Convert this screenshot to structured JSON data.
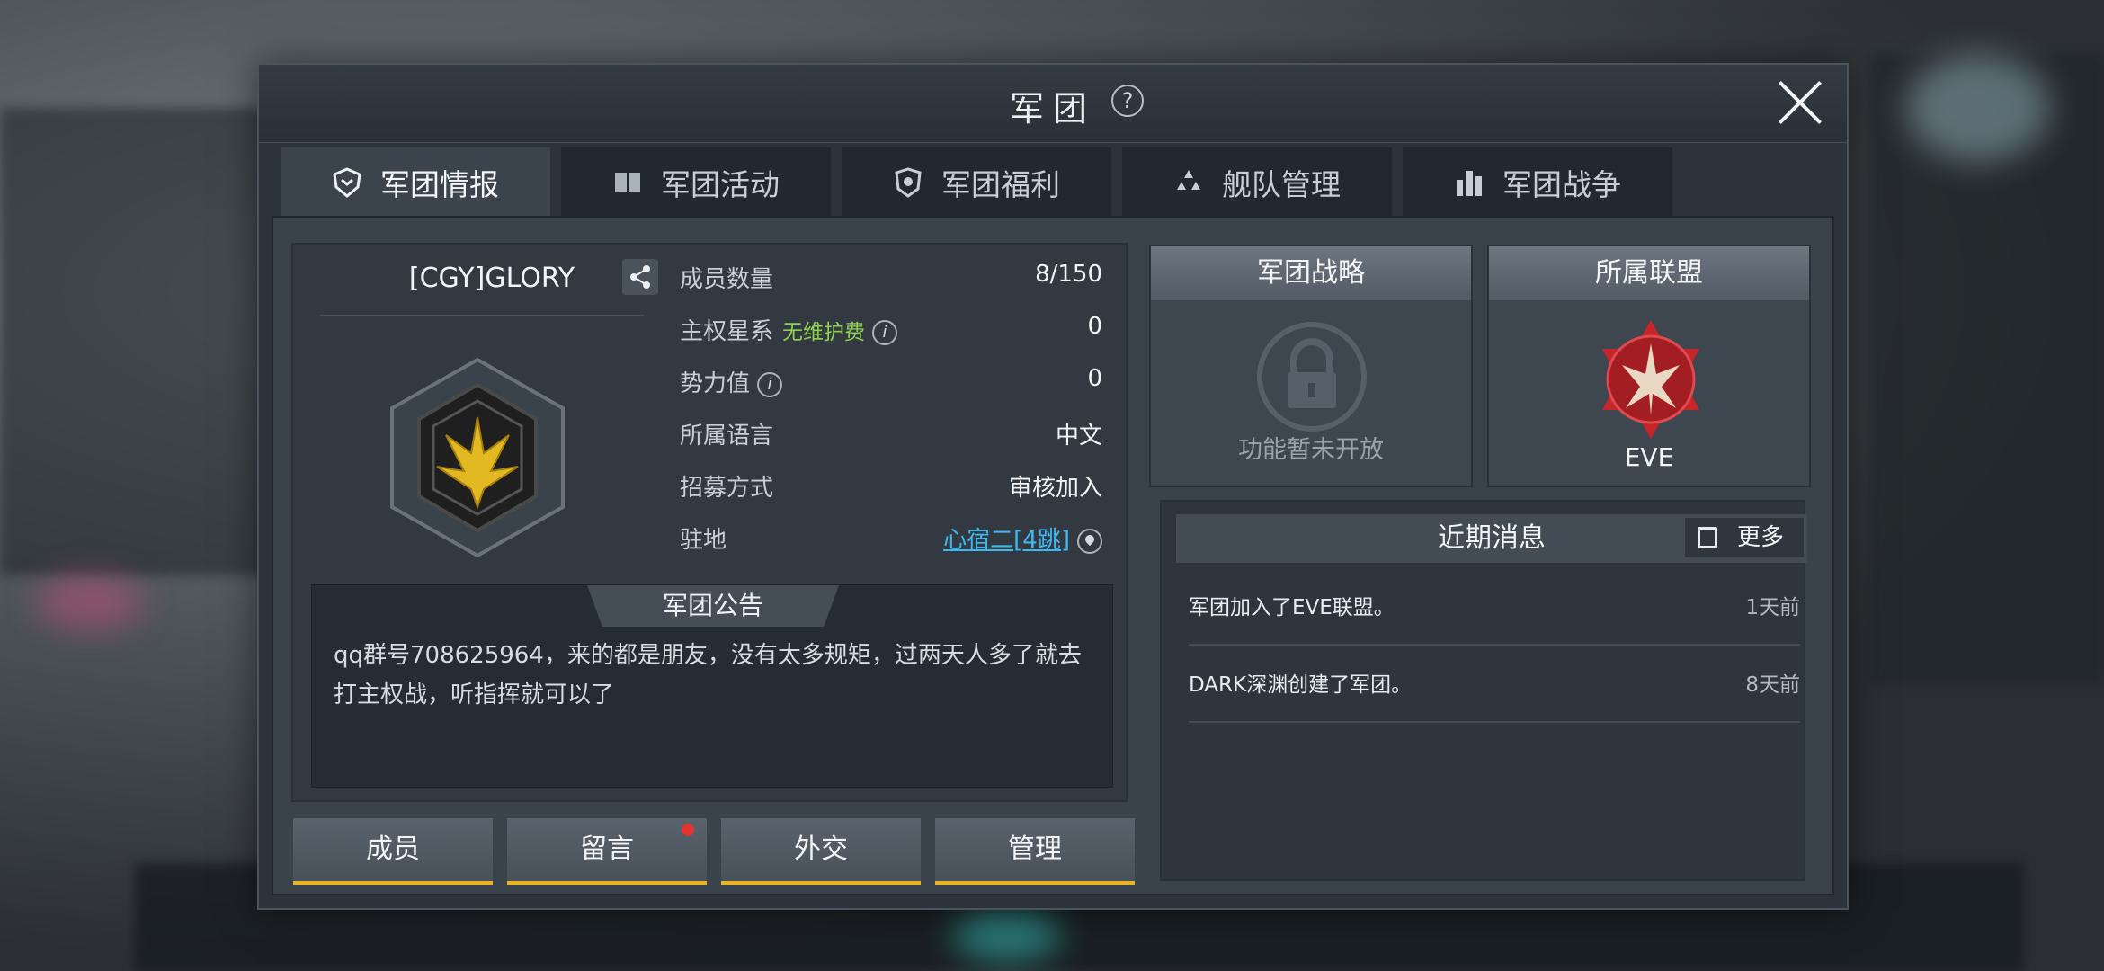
{
  "dialog": {
    "title": "军团",
    "help_icon": "?",
    "close_icon": "close-icon"
  },
  "tabs": [
    {
      "label": "军团情报",
      "icon": "shield-icon",
      "active": true
    },
    {
      "label": "军团活动",
      "icon": "book-icon",
      "active": false
    },
    {
      "label": "军团福利",
      "icon": "badge-icon",
      "active": false
    },
    {
      "label": "舰队管理",
      "icon": "fleet-icon",
      "active": false
    },
    {
      "label": "军团战争",
      "icon": "city-icon",
      "active": false
    }
  ],
  "guild": {
    "name": "[CGY]GLORY",
    "stats": [
      {
        "label": "成员数量",
        "value": "8/150"
      },
      {
        "label": "主权星系",
        "note": "无维护费",
        "value": "0"
      },
      {
        "label": "势力值",
        "value": "0"
      },
      {
        "label": "所属语言",
        "value": "中文"
      },
      {
        "label": "招募方式",
        "value": "审核加入"
      },
      {
        "label": "驻地",
        "value": "心宿二[4跳]"
      }
    ],
    "info_i": "i",
    "notice_title": "军团公告",
    "notice_text": "qq群号708625964，来的都是朋友，没有太多规矩，过两天人多了就去打主权战，听指挥就可以了"
  },
  "actions": [
    "成员",
    "留言",
    "外交",
    "管理"
  ],
  "strategy": {
    "title": "军团战略",
    "note": "功能暂未开放"
  },
  "alliance": {
    "title": "所属联盟",
    "name": "EVE"
  },
  "news": {
    "title": "近期消息",
    "more_label": "更多",
    "items": [
      {
        "text": "军团加入了EVE联盟。",
        "time": "1天前"
      },
      {
        "text": "DARK深渊创建了军团。",
        "time": "8天前"
      }
    ]
  },
  "colors": {
    "accent_gold": "#e8b422",
    "note_green": "#8fd14f",
    "link_blue": "#3fb8f0",
    "alert_red": "#e0342e"
  }
}
